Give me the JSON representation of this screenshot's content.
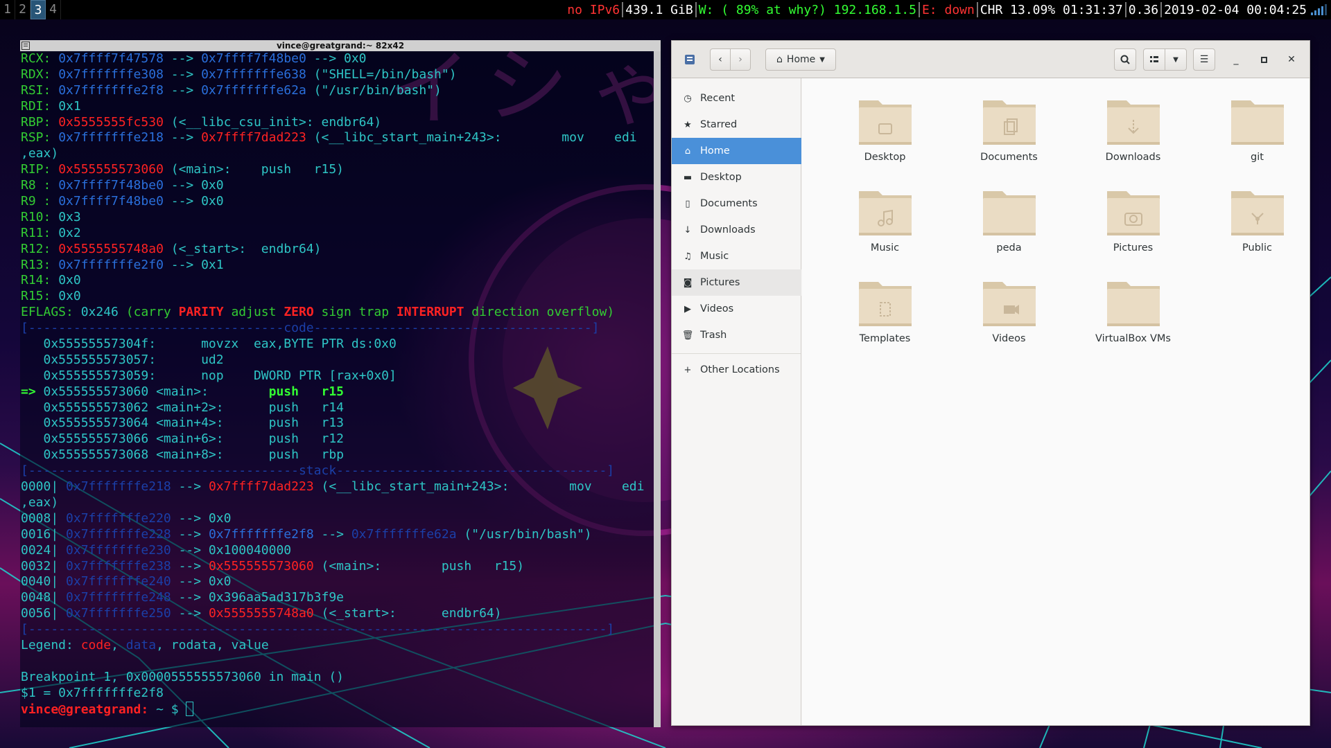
{
  "topbar": {
    "workspaces": [
      "1",
      "2",
      "3",
      "4"
    ],
    "active_workspace": "3",
    "ipv6": "no IPv6",
    "disk": "439.1 GiB",
    "wifi": "W: ( 89% at why?) 192.168.1.5",
    "ethernet": "E: down",
    "battery": "CHR 13.09% 01:31:37",
    "load": "0.36",
    "datetime": "2019-02-04 00:04:25"
  },
  "terminal": {
    "title": "vince@greatgrand:~ 82x42",
    "prompt_user": "vince@greatgrand:",
    "prompt_path": " ~ $ ",
    "lines": [
      [
        [
          "RCX: ",
          "g"
        ],
        [
          "0x7ffff7f47578",
          "b"
        ],
        [
          " --> ",
          "c"
        ],
        [
          "0x7ffff7f48be0",
          "b"
        ],
        [
          " --> 0x0",
          "c"
        ]
      ],
      [
        [
          "RDX: ",
          "g"
        ],
        [
          "0x7fffffffe308",
          "b"
        ],
        [
          " --> ",
          "c"
        ],
        [
          "0x7fffffffe638",
          "b"
        ],
        [
          " (\"SHELL=/bin/bash\")",
          "c"
        ]
      ],
      [
        [
          "RSI: ",
          "g"
        ],
        [
          "0x7fffffffe2f8",
          "b"
        ],
        [
          " --> ",
          "c"
        ],
        [
          "0x7fffffffe62a",
          "b"
        ],
        [
          " (\"/usr/bin/bash\")",
          "c"
        ]
      ],
      [
        [
          "RDI: ",
          "g"
        ],
        [
          "0x1",
          "c"
        ]
      ],
      [
        [
          "RBP: ",
          "g"
        ],
        [
          "0x5555555fc530",
          "r"
        ],
        [
          " (<__libc_csu_init>: endbr64)",
          "c"
        ]
      ],
      [
        [
          "RSP: ",
          "g"
        ],
        [
          "0x7fffffffe218",
          "b"
        ],
        [
          " --> ",
          "c"
        ],
        [
          "0x7ffff7dad223",
          "r"
        ],
        [
          " (<__libc_start_main+243>:        mov    edi",
          "c"
        ]
      ],
      [
        [
          ",eax)",
          "c"
        ]
      ],
      [
        [
          "RIP: ",
          "g"
        ],
        [
          "0x555555573060",
          "r"
        ],
        [
          " (<main>:    push   r15)",
          "c"
        ]
      ],
      [
        [
          "R8 : ",
          "g"
        ],
        [
          "0x7ffff7f48be0",
          "b"
        ],
        [
          " --> 0x0",
          "c"
        ]
      ],
      [
        [
          "R9 : ",
          "g"
        ],
        [
          "0x7ffff7f48be0",
          "b"
        ],
        [
          " --> 0x0",
          "c"
        ]
      ],
      [
        [
          "R10: ",
          "g"
        ],
        [
          "0x3",
          "c"
        ]
      ],
      [
        [
          "R11: ",
          "g"
        ],
        [
          "0x2",
          "c"
        ]
      ],
      [
        [
          "R12: ",
          "g"
        ],
        [
          "0x5555555748a0",
          "r"
        ],
        [
          " (<_start>:  endbr64)",
          "c"
        ]
      ],
      [
        [
          "R13: ",
          "g"
        ],
        [
          "0x7fffffffe2f0",
          "b"
        ],
        [
          " --> 0x1",
          "c"
        ]
      ],
      [
        [
          "R14: ",
          "g"
        ],
        [
          "0x0",
          "c"
        ]
      ],
      [
        [
          "R15: ",
          "g"
        ],
        [
          "0x0",
          "c"
        ]
      ],
      [
        [
          "EFLAGS: ",
          "g"
        ],
        [
          "0x246 ",
          "c"
        ],
        [
          "(carry ",
          "g"
        ],
        [
          "PARITY ",
          "br"
        ],
        [
          "adjust ",
          "g"
        ],
        [
          "ZERO ",
          "br"
        ],
        [
          "sign trap ",
          "g"
        ],
        [
          "INTERRUPT ",
          "br"
        ],
        [
          "direction overflow)",
          "g"
        ]
      ],
      [
        [
          "[----------------------------------code-------------------------------------]",
          "db"
        ]
      ],
      [
        [
          "   0x55555557304f:      movzx  eax,BYTE PTR ds:0x0",
          "c"
        ]
      ],
      [
        [
          "   0x555555573057:      ud2",
          "c"
        ]
      ],
      [
        [
          "   0x555555573059:      nop    DWORD PTR [rax+0x0]",
          "c"
        ]
      ],
      [
        [
          "=> ",
          "bg"
        ],
        [
          "0x555555573060 <main>:        ",
          "c"
        ],
        [
          "push   r15",
          "bg"
        ]
      ],
      [
        [
          "   0x555555573062 <main+2>:      push   r14",
          "c"
        ]
      ],
      [
        [
          "   0x555555573064 <main+4>:      push   r13",
          "c"
        ]
      ],
      [
        [
          "   0x555555573066 <main+6>:      push   r12",
          "c"
        ]
      ],
      [
        [
          "   0x555555573068 <main+8>:      push   rbp",
          "c"
        ]
      ],
      [
        [
          "[------------------------------------stack------------------------------------]",
          "db"
        ]
      ],
      [
        [
          "0000| ",
          "c"
        ],
        [
          "0x7fffffffe218",
          "db"
        ],
        [
          " --> ",
          "c"
        ],
        [
          "0x7ffff7dad223",
          "r"
        ],
        [
          " (<__libc_start_main+243>:        mov    edi",
          "c"
        ]
      ],
      [
        [
          ",eax)",
          "c"
        ]
      ],
      [
        [
          "0008| ",
          "c"
        ],
        [
          "0x7fffffffe220",
          "db"
        ],
        [
          " --> 0x0",
          "c"
        ]
      ],
      [
        [
          "0016| ",
          "c"
        ],
        [
          "0x7fffffffe228",
          "db"
        ],
        [
          " --> ",
          "c"
        ],
        [
          "0x7fffffffe2f8",
          "b"
        ],
        [
          " --> ",
          "c"
        ],
        [
          "0x7fffffffe62a",
          "db"
        ],
        [
          " (\"/usr/bin/bash\")",
          "c"
        ]
      ],
      [
        [
          "0024| ",
          "c"
        ],
        [
          "0x7fffffffe230",
          "db"
        ],
        [
          " --> 0x100040000",
          "c"
        ]
      ],
      [
        [
          "0032| ",
          "c"
        ],
        [
          "0x7fffffffe238",
          "db"
        ],
        [
          " --> ",
          "c"
        ],
        [
          "0x555555573060",
          "r"
        ],
        [
          " (<main>:        push   r15)",
          "c"
        ]
      ],
      [
        [
          "0040| ",
          "c"
        ],
        [
          "0x7fffffffe240",
          "db"
        ],
        [
          " --> 0x0",
          "c"
        ]
      ],
      [
        [
          "0048| ",
          "c"
        ],
        [
          "0x7fffffffe248",
          "db"
        ],
        [
          " --> 0x396aa5ad317b3f9e",
          "c"
        ]
      ],
      [
        [
          "0056| ",
          "c"
        ],
        [
          "0x7fffffffe250",
          "db"
        ],
        [
          " --> ",
          "c"
        ],
        [
          "0x5555555748a0",
          "r"
        ],
        [
          " (<_start>:      endbr64)",
          "c"
        ]
      ],
      [
        [
          "[-----------------------------------------------------------------------------]",
          "db"
        ]
      ],
      [
        [
          "Legend: ",
          "c"
        ],
        [
          "code",
          "r"
        ],
        [
          ", ",
          "c"
        ],
        [
          "data",
          "db"
        ],
        [
          ", ",
          "c"
        ],
        [
          "rodata",
          "c"
        ],
        [
          ", ",
          "c"
        ],
        [
          "value",
          "c"
        ]
      ],
      [
        [
          "",
          "c"
        ]
      ],
      [
        [
          "Breakpoint 1, 0x0000555555573060 in main ()",
          "c"
        ]
      ],
      [
        [
          "$1 = 0x7fffffffe2f8",
          "c"
        ]
      ]
    ]
  },
  "filemanager": {
    "location": "Home",
    "sidebar": [
      {
        "label": "Recent",
        "icon": "clock-icon",
        "glyph": "◷",
        "state": ""
      },
      {
        "label": "Starred",
        "icon": "star-icon",
        "glyph": "★",
        "state": ""
      },
      {
        "label": "Home",
        "icon": "home-icon",
        "glyph": "⌂",
        "state": "active"
      },
      {
        "label": "Desktop",
        "icon": "desktop-folder-icon",
        "glyph": "▬",
        "state": ""
      },
      {
        "label": "Documents",
        "icon": "document-icon",
        "glyph": "▯",
        "state": ""
      },
      {
        "label": "Downloads",
        "icon": "download-icon",
        "glyph": "↓",
        "state": ""
      },
      {
        "label": "Music",
        "icon": "music-icon",
        "glyph": "♫",
        "state": ""
      },
      {
        "label": "Pictures",
        "icon": "camera-icon",
        "glyph": "◙",
        "state": "hover"
      },
      {
        "label": "Videos",
        "icon": "video-icon",
        "glyph": "▶",
        "state": ""
      },
      {
        "label": "Trash",
        "icon": "trash-icon",
        "glyph": "🗑",
        "state": ""
      }
    ],
    "other_locations": "Other Locations",
    "folders": [
      {
        "label": "Desktop",
        "emblem": "desktop"
      },
      {
        "label": "Documents",
        "emblem": "documents"
      },
      {
        "label": "Downloads",
        "emblem": "download"
      },
      {
        "label": "git",
        "emblem": ""
      },
      {
        "label": "Music",
        "emblem": "music"
      },
      {
        "label": "peda",
        "emblem": ""
      },
      {
        "label": "Pictures",
        "emblem": "camera"
      },
      {
        "label": "Public",
        "emblem": "share"
      },
      {
        "label": "Templates",
        "emblem": "template"
      },
      {
        "label": "Videos",
        "emblem": "video"
      },
      {
        "label": "VirtualBox VMs",
        "emblem": ""
      }
    ],
    "colors": {
      "accent": "#4a90d9",
      "folder": "#eadcc4",
      "folder_tab": "#d9c8a8"
    }
  }
}
